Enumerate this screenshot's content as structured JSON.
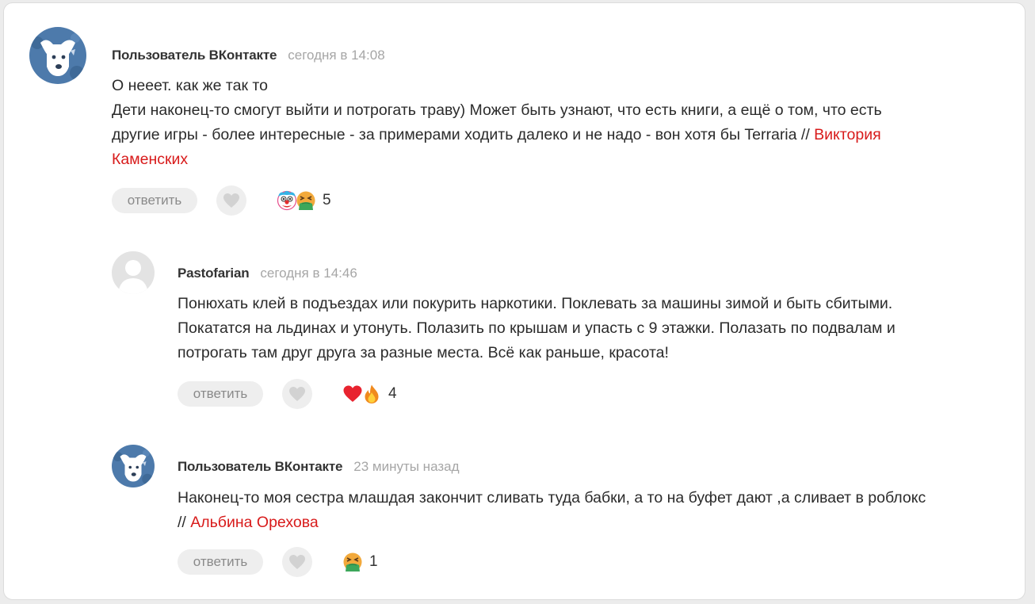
{
  "comments": [
    {
      "author": "Пользователь ВКонтакте",
      "time": "сегодня в 14:08",
      "avatar": "vk-dog-avatar",
      "lines": [
        "О нееет. как же так то",
        "Дети наконец-то смогут выйти и потрогать траву) Может быть узнают, что есть книги, а ещё о том, что есть",
        "другие игры - более интересные - за примерами ходить далеко и не надо - вон хотя бы Terraria // ",
        "Каменских"
      ],
      "mention_part1": "Виктория",
      "reply_label": "ответить",
      "reaction_icons": [
        "clown-emoji",
        "vomiting-emoji"
      ],
      "reaction_count": "5"
    },
    {
      "author": "Pastofarian",
      "time": "сегодня в 14:46",
      "avatar": "default-user-avatar",
      "lines": [
        "Понюхать клей в подъездах или покурить наркотики. Поклевать за машины зимой и быть сбитыми.",
        "Покататся на льдинах и утонуть. Полазить по крышам и упасть с 9 этажки. Полазать по подвалам и",
        "потрогать там друг друга за разные места. Всё как раньше, красота!"
      ],
      "reply_label": "ответить",
      "reaction_icons": [
        "heart-emoji",
        "fire-emoji"
      ],
      "reaction_count": "4"
    },
    {
      "author": "Пользователь ВКонтакте",
      "time": "23 минуты назад",
      "avatar": "vk-dog-avatar",
      "lines": [
        "Наконец-то моя сестра млашдая закончит сливать туда бабки, а то на буфет дают ,а сливает в роблокс",
        "// "
      ],
      "mention": "Альбина Орехова",
      "reply_label": "ответить",
      "reaction_icons": [
        "vomiting-emoji"
      ],
      "reaction_count": "1"
    }
  ],
  "colors": {
    "mention": "#d81b1b",
    "timestamp": "#a6a6a6",
    "button_bg": "#eeeeee",
    "avatar_blue": "#4a76a8"
  }
}
